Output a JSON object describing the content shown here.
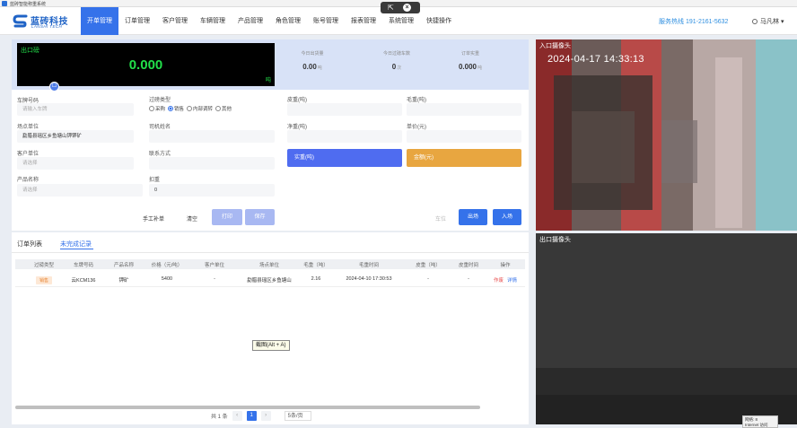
{
  "window": {
    "title": "蓝砖智能称重系统"
  },
  "overlay": {
    "icon_left": "⇱",
    "icon_close": "×"
  },
  "brand": {
    "name": "蓝砖科技",
    "en": "LANSHI TECH"
  },
  "nav": {
    "items": [
      "开单管理",
      "订单管理",
      "客户管理",
      "车辆管理",
      "产品管理",
      "角色管理",
      "账号管理",
      "报表管理",
      "系统管理",
      "快捷操作"
    ],
    "active_index": 0,
    "hotline": "服务热线 191-2161-5632",
    "user": "马凡林"
  },
  "weight": {
    "label": "出口磅",
    "value": "0.000",
    "unit": "吨",
    "camera_icon": "☐"
  },
  "stats": [
    {
      "label": "今日出货量",
      "value": "0.00",
      "unit": "吨"
    },
    {
      "label": "今日过磅车数",
      "value": "0",
      "unit": "次"
    },
    {
      "label": "订单实重",
      "value": "0.000",
      "unit": "吨"
    }
  ],
  "form": {
    "plate": {
      "label": "车牌号码",
      "placeholder": "请输入车牌"
    },
    "type": {
      "label": "过磅类型",
      "options": [
        "采购",
        "销售",
        "内部调转",
        "其他"
      ],
      "selected": 1
    },
    "origin": {
      "label": "场点单位",
      "value": "勐腊县瑶区乡鱼塘山钾钾矿"
    },
    "driver": {
      "label": "司机姓名",
      "value": ""
    },
    "customer": {
      "label": "客户单位",
      "placeholder": "请选择"
    },
    "contact": {
      "label": "联系方式",
      "value": ""
    },
    "product": {
      "label": "产品名称",
      "placeholder": "请选择"
    },
    "deduct": {
      "label": "扣重",
      "value": "0"
    },
    "tare": {
      "label": "皮重(吨)",
      "value": ""
    },
    "gross": {
      "label": "毛重(吨)",
      "value": ""
    },
    "net": {
      "label": "净重(吨)",
      "value": ""
    },
    "price": {
      "label": "单价(元)",
      "value": ""
    },
    "actual_btn": "实重(吨)",
    "amount_btn": "金额(元)"
  },
  "actions": {
    "manual": "手工补单",
    "clear": "清空",
    "print": "打印",
    "save": "保存",
    "exit_small": "车位",
    "out": "出场",
    "in": "入场"
  },
  "orders": {
    "tabs": [
      "订单列表",
      "未完成记录"
    ],
    "active_tab": 1,
    "columns": [
      "过磅类型",
      "车牌号码",
      "产品名称",
      "价格（元/吨）",
      "客户单位",
      "场点单位",
      "毛重（吨）",
      "毛重时间",
      "皮重（吨）",
      "皮重时间",
      "操作"
    ],
    "rows": [
      {
        "type": "销售",
        "plate": "云KCM136",
        "product": "钾矿",
        "price": "5400",
        "customer": "-",
        "origin": "勐腊县瑶区乡鱼塘山",
        "gross": "2.16",
        "gross_time": "2024-04-10 17:30:53",
        "tare": "-",
        "tare_time": "-",
        "op_del": "作废",
        "op_detail": "详情"
      }
    ],
    "tooltip": "截图(Alt + A)",
    "pager": {
      "total": "共 1 条",
      "prev": "‹",
      "page": "1",
      "next": "›",
      "size": "5条/页"
    }
  },
  "cameras": {
    "entry": {
      "title": "入口摄像头",
      "timestamp": "2024-04-17 14:33:13"
    },
    "exit": {
      "title": "出口摄像头"
    }
  },
  "statusbar": {
    "line1": "网络: 8",
    "line2": "Internet 访问"
  }
}
